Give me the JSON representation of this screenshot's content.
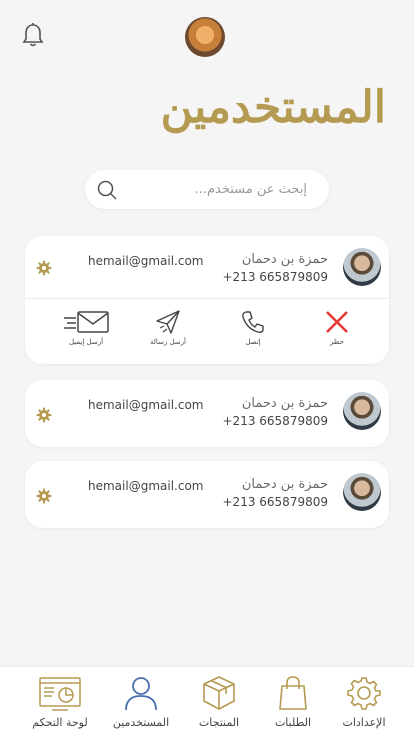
{
  "header": {
    "title": "المستخدمين"
  },
  "search": {
    "placeholder": "إبحث عن مستخدم..."
  },
  "users": [
    {
      "name": "حمزة بن دحمان",
      "phone": "+213 665879809",
      "email": "hemail@gmail.com",
      "expanded": true
    },
    {
      "name": "حمزة بن دحمان",
      "phone": "+213 665879809",
      "email": "hemail@gmail.com",
      "expanded": false
    },
    {
      "name": "حمزة بن دحمان",
      "phone": "+213 665879809",
      "email": "hemail@gmail.com",
      "expanded": false
    }
  ],
  "actions": {
    "block": "حظر",
    "call": "إتصل",
    "message": "أرسل رسالة",
    "email": "أرسل إيميل"
  },
  "tabs": [
    {
      "label": "الإعدادات",
      "icon": "gear-icon"
    },
    {
      "label": "الطلبات",
      "icon": "shopping-bag-icon"
    },
    {
      "label": "المنتجات",
      "icon": "box-icon"
    },
    {
      "label": "المستخدمين",
      "icon": "user-icon",
      "active": true
    },
    {
      "label": "لوحة التحكم",
      "icon": "dashboard-icon"
    }
  ],
  "colors": {
    "accent": "#b59a52",
    "active": "#4a6fb0",
    "block": "#e53935"
  }
}
